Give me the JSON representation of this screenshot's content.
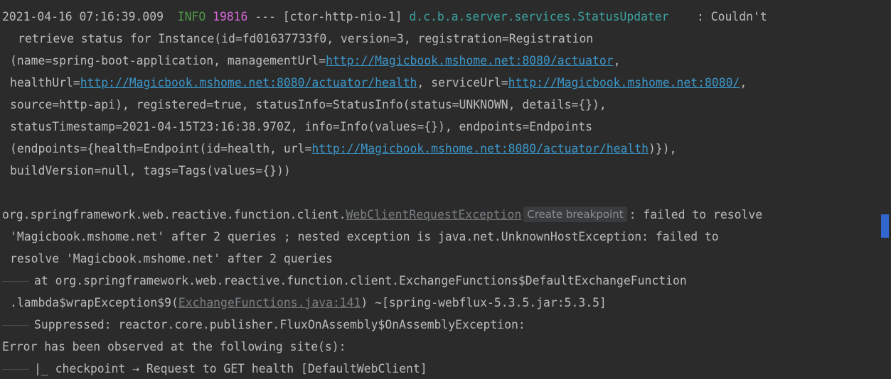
{
  "log": {
    "timestamp": "2021-04-16 07:16:39.009",
    "level": "INFO",
    "pid": "19816",
    "sep": "---",
    "thread": "[ctor-http-nio-1]",
    "logger": "d.c.b.a.server.services.StatusUpdater",
    "colon_msg": ": Couldn't",
    "l2": "retrieve status for Instance(id=fd01637733f0, version=3, registration=Registration",
    "l3_pre": "(name=spring-boot-application, managementUrl=",
    "l3_link": "http://Magicbook.mshome.net:8080/actuator",
    "l3_post": ",",
    "l4_pre": "healthUrl=",
    "l4_link1": "http://Magicbook.mshome.net:8080/actuator/health",
    "l4_mid": ", serviceUrl=",
    "l4_link2": "http://Magicbook.mshome.net:8080/",
    "l4_post": ",",
    "l5": "source=http-api), registered=true, statusInfo=StatusInfo(status=UNKNOWN, details={}),",
    "l6": "statusTimestamp=2021-04-15T23:16:38.970Z, info=Info(values={}), endpoints=Endpoints",
    "l7_pre": "(endpoints={health=Endpoint(id=health, url=",
    "l7_link": "http://Magicbook.mshome.net:8080/actuator/health",
    "l7_post": ")}),",
    "l8": "buildVersion=null, tags=Tags(values={}))"
  },
  "exception": {
    "pkg": "org.springframework.web.reactive.function.client.",
    "class_link": "WebClientRequestException",
    "badge": "Create breakpoint",
    "msg1": ": failed to resolve",
    "msg2": "'Magicbook.mshome.net' after 2 queries ; nested exception is java.net.UnknownHostException: failed to",
    "msg3": "resolve 'Magicbook.mshome.net' after 2 queries",
    "at1": "at org.springframework.web.reactive.function.client.ExchangeFunctions$DefaultExchangeFunction",
    "at2_pre": ".lambda$wrapException$9(",
    "at2_src": "ExchangeFunctions.java:141",
    "at2_post": ") ~[spring-webflux-5.3.5.jar:5.3.5]",
    "suppressed": "Suppressed: reactor.core.publisher.FluxOnAssembly$OnAssemblyException:",
    "error_line": "Error has been observed at the following site(s):",
    "checkpoint": "|_ checkpoint ⇢ Request to GET health [DefaultWebClient]"
  }
}
